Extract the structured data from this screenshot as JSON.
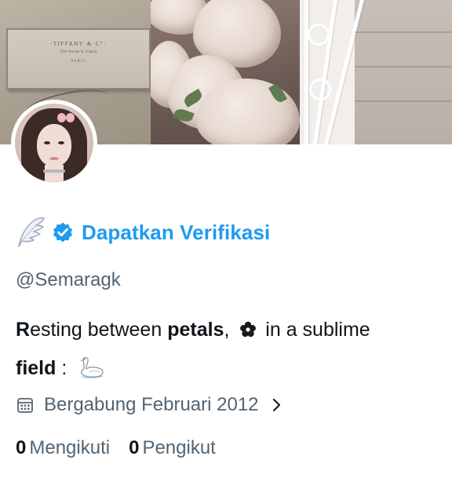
{
  "banner": {
    "tiffany_lines": [
      "·TIFFANY·&·C°·",
      "56th Avenue & 1'Opera",
      "·PARIS·"
    ]
  },
  "profile": {
    "verify_label": "Dapatkan Verifikasi",
    "handle": "@Semaragk",
    "bio": {
      "part1_lead": "R",
      "part1_rest": "esting between ",
      "bold1": "petals",
      "part2": ", ",
      "part3": " in a sublime",
      "bold2": "field",
      "part4": " : "
    },
    "joined": "Bergabung Februari 2012",
    "following_count": "0",
    "following_label": "Mengikuti",
    "followers_count": "0",
    "followers_label": "Pengikut"
  },
  "icons": {
    "verified": "verified-badge-icon",
    "wing": "wing-icon",
    "flower": "flower-icon",
    "swan": "swan-icon",
    "calendar": "calendar-icon",
    "chevron": "chevron-right-icon"
  },
  "colors": {
    "accent": "#1d9bf0",
    "text_primary": "#0f1419",
    "text_secondary": "#536471"
  }
}
